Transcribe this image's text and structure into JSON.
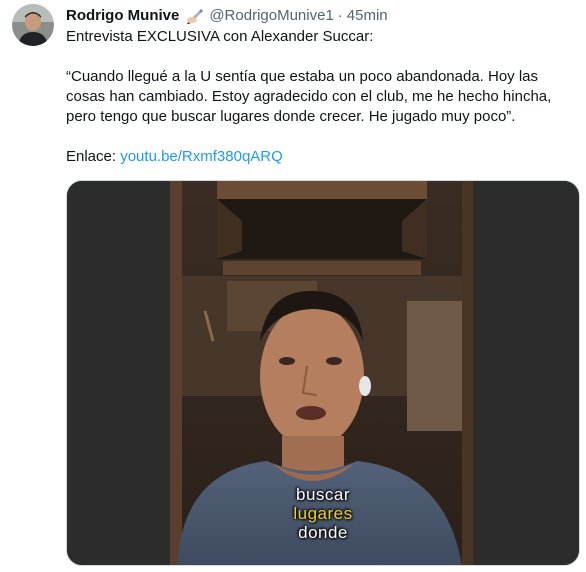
{
  "tweet": {
    "author_name": "Rodrigo Munive",
    "author_badge_emoji": "✍🏻",
    "handle": "@RodrigoMunive1",
    "separator": "·",
    "time": "45min",
    "intro": "Entrevista EXCLUSIVA con Alexander Succar:",
    "quote": "“Cuando llegué a la U sentía que estaba un poco abandonada. Hoy las cosas han cambiado. Estoy agradecido con el club, me he hecho hincha, pero tengo que buscar lugares donde crecer. He jugado muy poco”.",
    "link_prefix": "Enlace:",
    "link_text": "youtu.be/Rxmf380qARQ"
  },
  "media": {
    "caption_lines": [
      "buscar",
      "lugares",
      "donde"
    ],
    "caption_highlight_color": "#f2d21b"
  },
  "colors": {
    "link": "#1d9bf0",
    "secondary_text": "#536471",
    "primary_text": "#0f1419"
  }
}
